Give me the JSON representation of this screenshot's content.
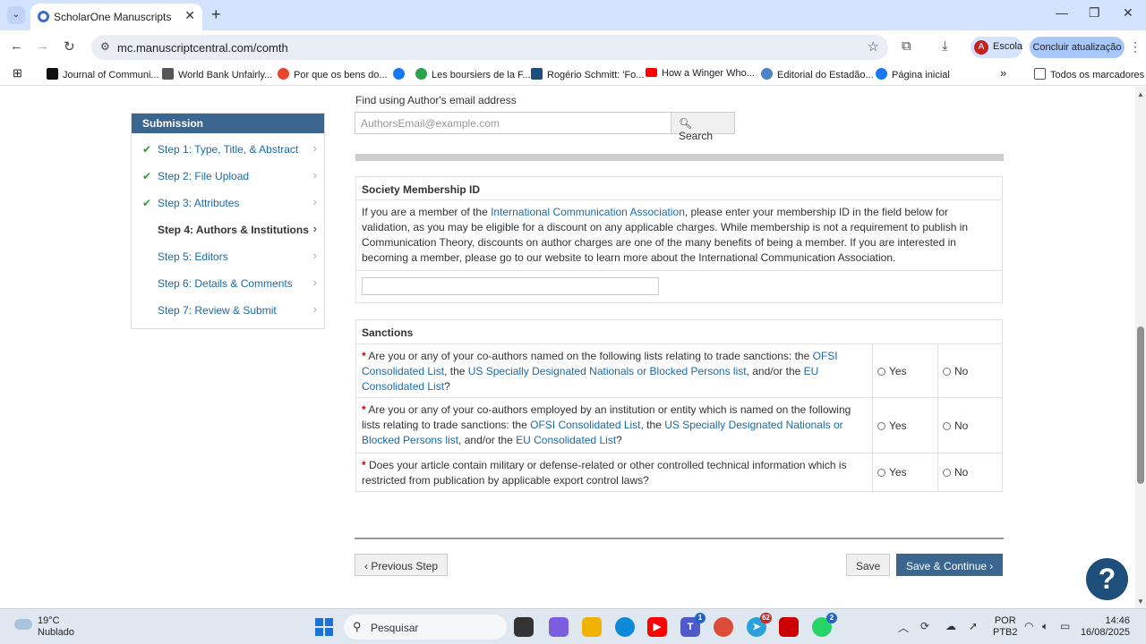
{
  "browser": {
    "tab_title": "ScholarOne Manuscripts",
    "url": "mc.manuscriptcentral.com/comth",
    "profile_initial": "A",
    "profile_name": "Escola",
    "update_label": "Concluir atualização",
    "bookmarks": [
      {
        "label": "Journal of Communi...",
        "color": "#111111"
      },
      {
        "label": "World Bank Unfairly...",
        "color": "#555555"
      },
      {
        "label": "Por que os bens do...",
        "color": "#e8452c"
      },
      {
        "label": "",
        "color": "#1877f2"
      },
      {
        "label": "Les boursiers de la F...",
        "color": "#2ba24c"
      },
      {
        "label": "Rogério Schmitt: 'Fo...",
        "color": "#1d4f7a"
      },
      {
        "label": "How a Winger Who...",
        "color": "#ff0000"
      },
      {
        "label": "Editorial do Estadão...",
        "color": "#4b82c8"
      },
      {
        "label": "Página inicial",
        "color": "#1877f2"
      }
    ],
    "all_bookmarks": "Todos os marcadores"
  },
  "sidebar": {
    "header": "Submission",
    "steps": [
      {
        "label": "Step 1: Type, Title, & Abstract",
        "done": true
      },
      {
        "label": "Step 2: File Upload",
        "done": true
      },
      {
        "label": "Step 3: Attributes",
        "done": true
      },
      {
        "label": "Step 4: Authors & Institutions",
        "done": false,
        "current": true
      },
      {
        "label": "Step 5: Editors",
        "done": false
      },
      {
        "label": "Step 6: Details & Comments",
        "done": false
      },
      {
        "label": "Step 7: Review & Submit",
        "done": false
      }
    ]
  },
  "author_search": {
    "label": "Find using Author's email address",
    "placeholder": "AuthorsEmail@example.com",
    "button": "Search"
  },
  "society": {
    "title": "Society Membership ID",
    "text_pre": "If you are a member of the ",
    "text_link": "International Communication Association",
    "text_post": ", please enter your membership ID in the field below for validation, as you may be eligible for a discount on any applicable charges. While membership is not a requirement to publish in Communication Theory, discounts on author charges are one of the many benefits of being a member. If you are interested in becoming a member, please go to our website to learn more about the International Communication Association.",
    "input_value": ""
  },
  "sanctions": {
    "title": "Sanctions",
    "yes": "Yes",
    "no": "No",
    "q1": {
      "a": "Are you or any of your co-authors named on the following lists relating to trade sanctions: the ",
      "l1": "OFSI Consolidated List",
      "b": ", the ",
      "l2": "US Specially Designated Nationals or Blocked Persons list",
      "c": ", and/or the ",
      "l3": "EU Consolidated List",
      "d": "?"
    },
    "q2": {
      "a": "Are you or any of your co-authors employed by an institution or entity which is named on the following lists relating to trade sanctions: the ",
      "l1": "OFSI Consolidated List",
      "b": ", the ",
      "l2": "US Specially Designated Nationals or Blocked Persons list",
      "c": ", and/or the ",
      "l3": "EU Consolidated List",
      "d": "?"
    },
    "q3": "Does your article contain military or defense-related or other controlled technical information which is restricted from publication by applicable export control laws?"
  },
  "footer_buttons": {
    "previous": "Previous Step",
    "save": "Save",
    "save_continue": "Save & Continue"
  },
  "taskbar": {
    "temp": "19°C",
    "weather": "Nublado",
    "search": "Pesquisar",
    "teams_badge": "1",
    "telegram_badge": "62",
    "whatsapp_badge": "2",
    "lang1": "POR",
    "lang2": "PTB2",
    "time": "14:46",
    "date": "16/08/2025"
  }
}
